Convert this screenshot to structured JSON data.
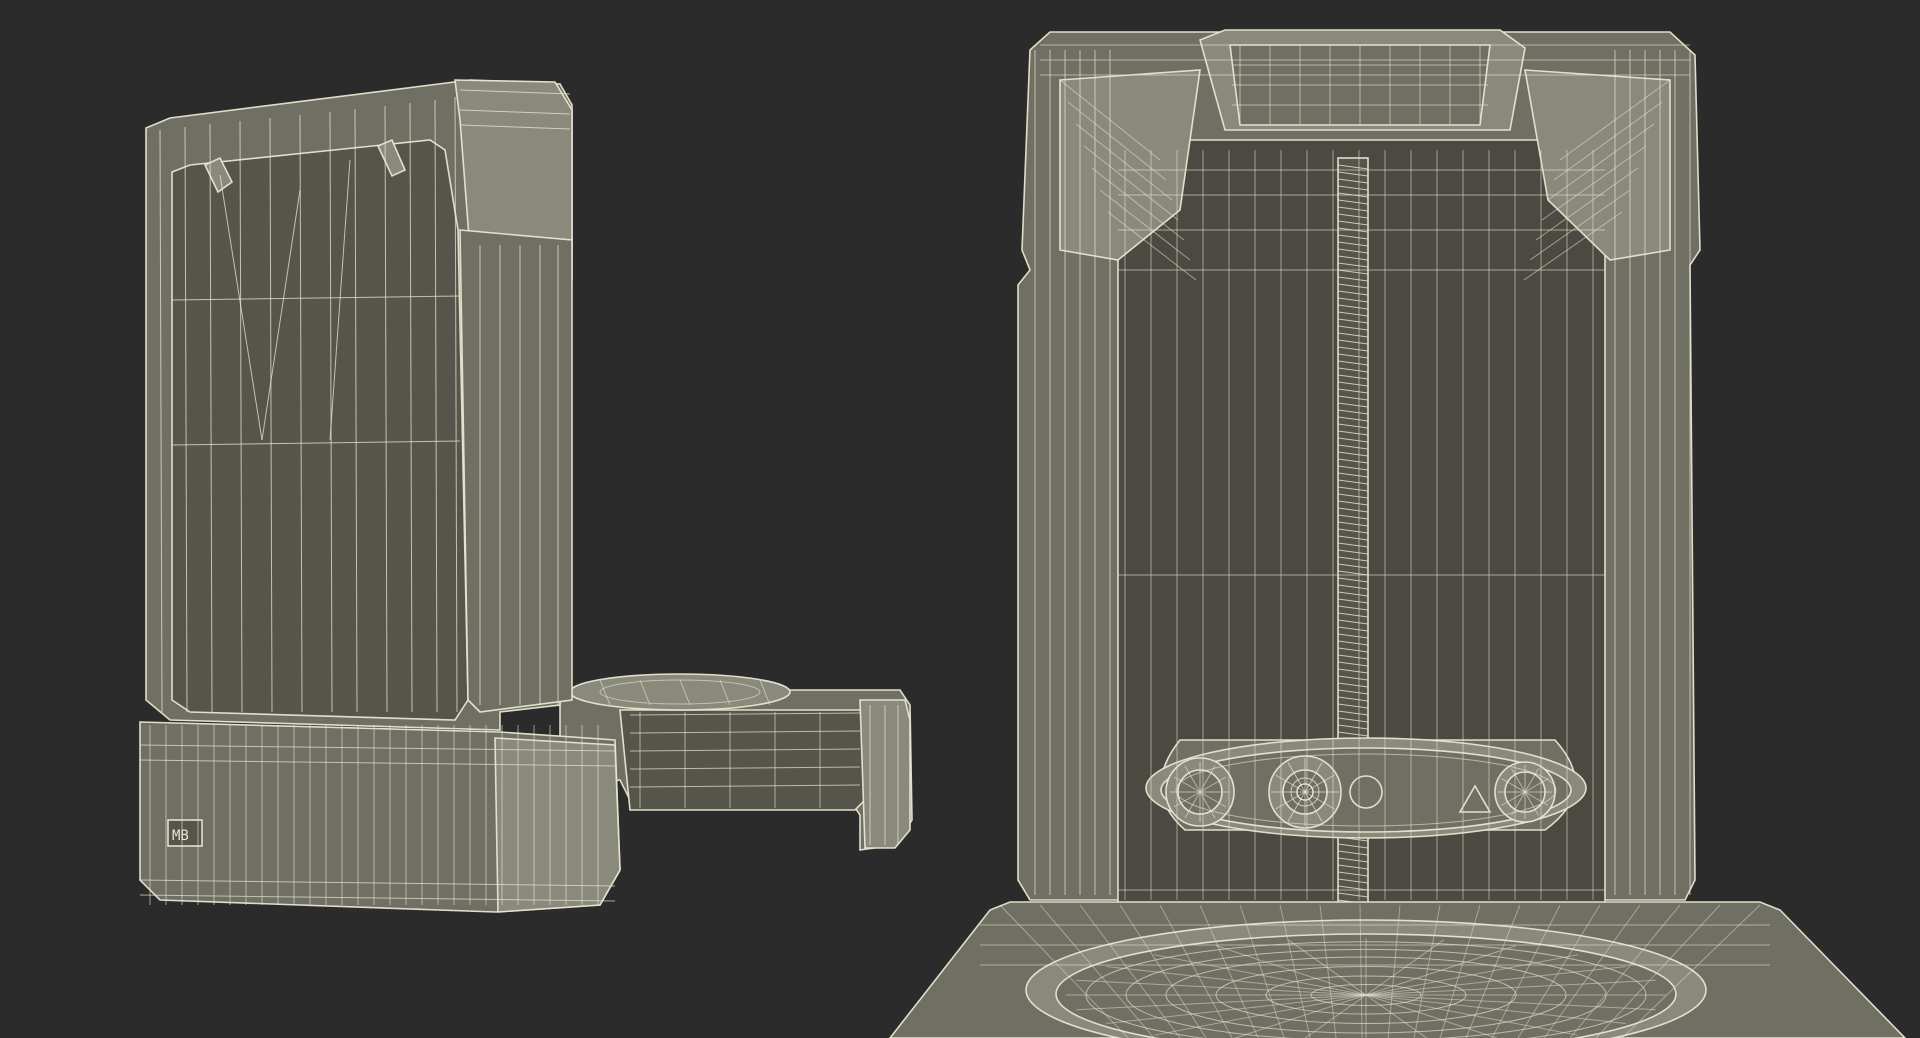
{
  "scene": {
    "background": "#2b2b2b",
    "object_fill": "#6f6f63",
    "object_fill_light": "#8a8a7c",
    "object_fill_dark": "#55554b",
    "cavity_fill": "#4a4a42",
    "wire_color": "#e8e6d2",
    "views": [
      {
        "name": "side-view",
        "label": ""
      },
      {
        "name": "front-view",
        "label": ""
      }
    ],
    "control_panel_symbols": [
      "circle-symbol",
      "triangle-symbol"
    ],
    "logo_text": "MB"
  }
}
